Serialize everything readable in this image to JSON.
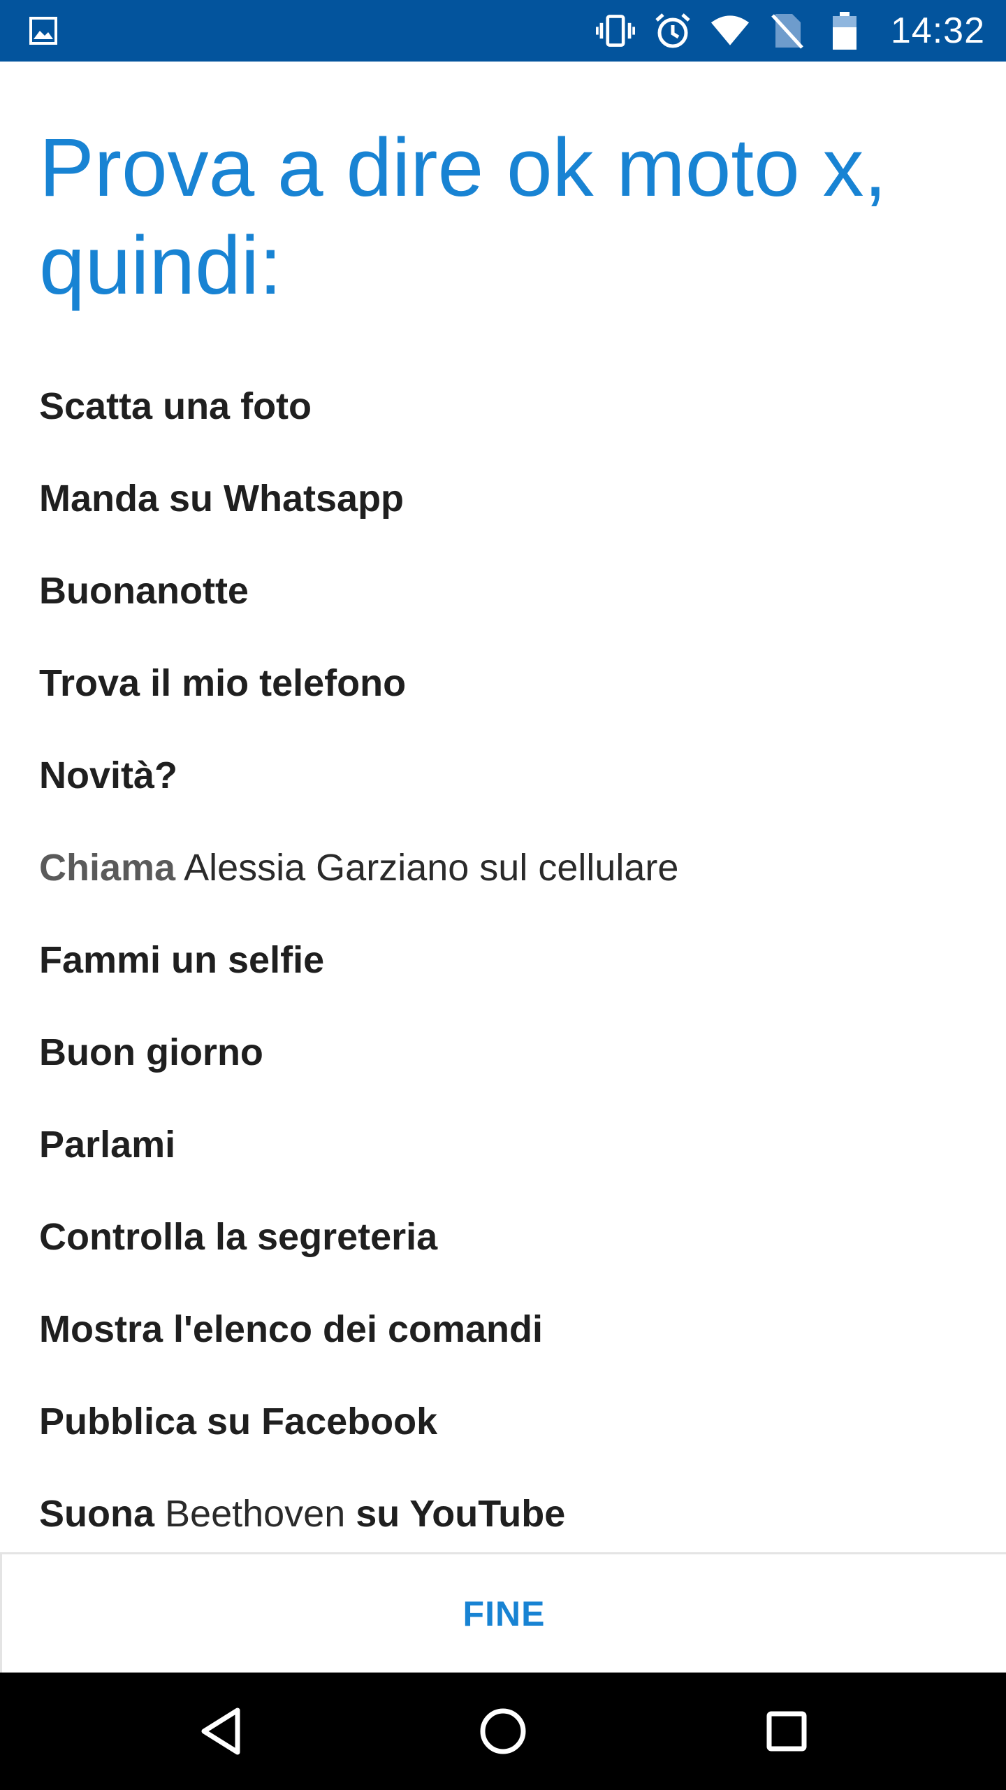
{
  "status_bar": {
    "time": "14:32",
    "left_icon": "image-icon",
    "icons": [
      "vibrate-icon",
      "alarm-icon",
      "wifi-icon",
      "no-sim-icon",
      "battery-icon"
    ],
    "background_color": "#03549d"
  },
  "title": "Prova a dire ok moto x, quindi:",
  "accent_color": "#1883d3",
  "commands": [
    {
      "parts": [
        {
          "text": "Scatta una foto",
          "style": "bold"
        }
      ]
    },
    {
      "parts": [
        {
          "text": "Manda su Whatsapp",
          "style": "bold"
        }
      ]
    },
    {
      "parts": [
        {
          "text": "Buonanotte",
          "style": "bold"
        }
      ]
    },
    {
      "parts": [
        {
          "text": "Trova il mio telefono",
          "style": "bold"
        }
      ]
    },
    {
      "parts": [
        {
          "text": "Novità?",
          "style": "bold"
        }
      ]
    },
    {
      "parts": [
        {
          "text": "Chiama",
          "style": "grey-bold"
        },
        {
          "text": " Alessia Garziano sul cellulare",
          "style": "regular"
        }
      ]
    },
    {
      "parts": [
        {
          "text": "Fammi un selfie",
          "style": "bold"
        }
      ]
    },
    {
      "parts": [
        {
          "text": "Buon giorno",
          "style": "bold"
        }
      ]
    },
    {
      "parts": [
        {
          "text": "Parlami",
          "style": "bold"
        }
      ]
    },
    {
      "parts": [
        {
          "text": "Controlla la segreteria",
          "style": "bold"
        }
      ]
    },
    {
      "parts": [
        {
          "text": "Mostra l'elenco dei comandi",
          "style": "bold"
        }
      ]
    },
    {
      "parts": [
        {
          "text": "Pubblica su Facebook",
          "style": "bold"
        }
      ]
    },
    {
      "parts": [
        {
          "text": "Suona",
          "style": "bold"
        },
        {
          "text": " Beethoven ",
          "style": "regular"
        },
        {
          "text": "su YouTube",
          "style": "bold"
        }
      ]
    }
  ],
  "footer": {
    "button_label": "FINE"
  },
  "nav_bar": {
    "buttons": [
      "back-icon",
      "home-icon",
      "recents-icon"
    ]
  }
}
